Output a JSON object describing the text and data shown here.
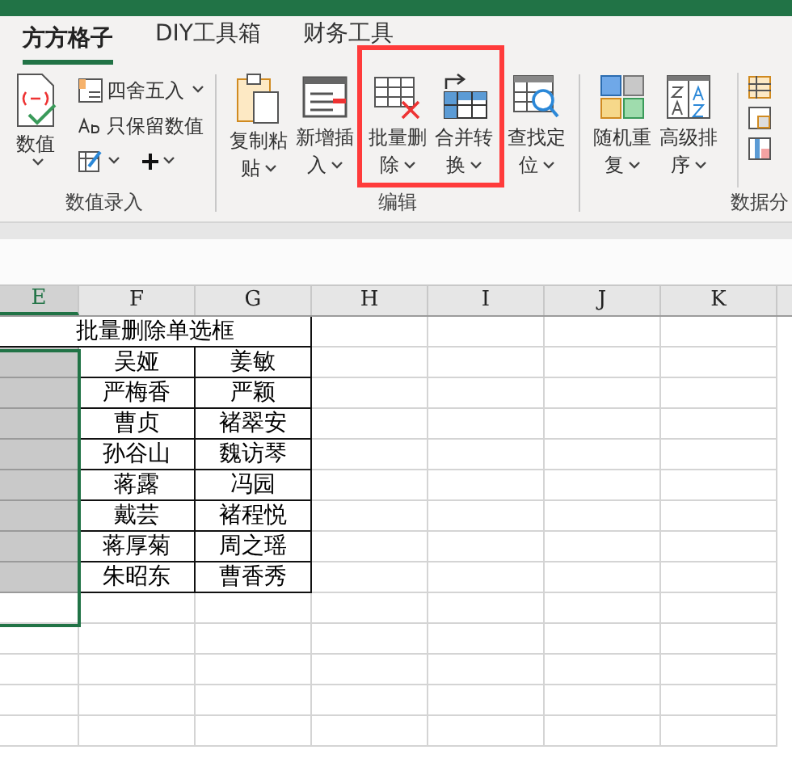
{
  "tabs": [
    {
      "label": "方方格子",
      "selected": true
    },
    {
      "label": "DIY工具箱",
      "selected": false
    },
    {
      "label": "财务工具",
      "selected": false
    }
  ],
  "ribbon": {
    "groups": [
      {
        "label": "数值录入",
        "large": [
          {
            "lines": [
              "数值"
            ],
            "dropdown": true
          }
        ],
        "small": [
          {
            "label": "四舍五入",
            "dropdown": true
          },
          {
            "label": "只保留数值",
            "dropdown": false
          }
        ]
      },
      {
        "label": "编辑",
        "large": [
          {
            "lines": [
              "复制粘",
              "贴"
            ],
            "dropdown": true
          },
          {
            "lines": [
              "新增插",
              "入"
            ],
            "dropdown": true
          },
          {
            "lines": [
              "批量删",
              "除"
            ],
            "dropdown": true
          },
          {
            "lines": [
              "合并转",
              "换"
            ],
            "dropdown": true
          },
          {
            "lines": [
              "查找定",
              "位"
            ],
            "dropdown": true
          }
        ]
      },
      {
        "label": "数据分",
        "large": [
          {
            "lines": [
              "随机重",
              "复"
            ],
            "dropdown": true
          },
          {
            "lines": [
              "高级排",
              "序"
            ],
            "dropdown": true
          }
        ]
      }
    ]
  },
  "sheet": {
    "columns": [
      {
        "label": "E",
        "selected": true
      },
      {
        "label": "F",
        "selected": false
      },
      {
        "label": "G",
        "selected": false
      },
      {
        "label": "H",
        "selected": false
      },
      {
        "label": "I",
        "selected": false
      },
      {
        "label": "J",
        "selected": false
      },
      {
        "label": "K",
        "selected": false
      }
    ],
    "title": "批量删除单选框",
    "rows": [
      [
        "",
        "吴娅",
        "姜敏"
      ],
      [
        "",
        "严梅香",
        "严颖"
      ],
      [
        "",
        "曹贞",
        "褚翠安"
      ],
      [
        "",
        "孙谷山",
        "魏访琴"
      ],
      [
        "",
        "蒋露",
        "冯园"
      ],
      [
        "",
        "戴芸",
        "褚程悦"
      ],
      [
        "",
        "蒋厚菊",
        "周之瑶"
      ],
      [
        "",
        "朱昭东",
        "曹香秀"
      ]
    ]
  }
}
